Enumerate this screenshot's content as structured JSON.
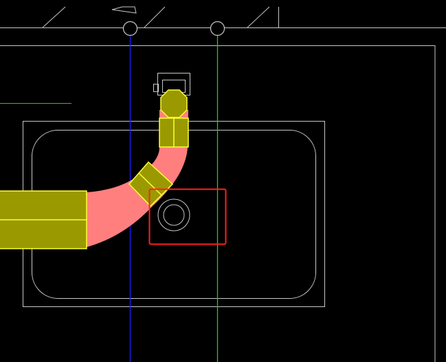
{
  "canvas": {
    "background": "#000000",
    "chrome_color": "#f0f0f0"
  },
  "colors": {
    "outline": "#c8c8c8",
    "axis_blue": "#1a1aff",
    "axis_green": "#22cc22",
    "pipe_pink": "#ff7f7f",
    "fitting_fill": "#9a9a00",
    "fitting_stroke": "#ffff33",
    "selection_red": "#ff2020"
  },
  "icons": {
    "axis_marker": "circle-outline",
    "drain": "concentric-circles",
    "fitting_head": "octagon"
  },
  "selection": {
    "target": "sink-drain",
    "active": true
  }
}
